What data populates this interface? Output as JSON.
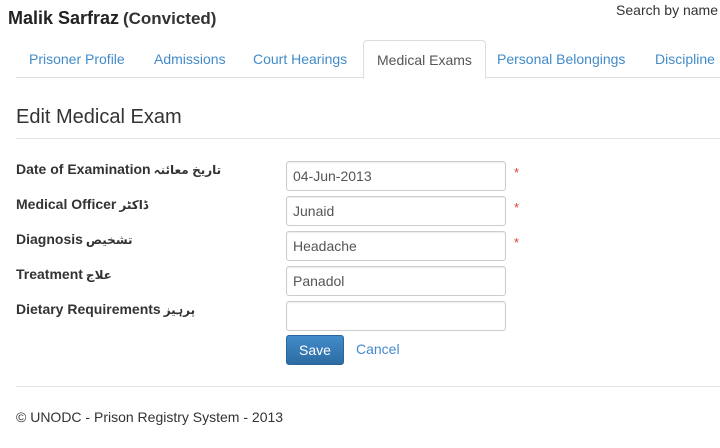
{
  "header": {
    "name": "Malik Sarfraz",
    "status": "(Convicted)",
    "search_link": "Search by name"
  },
  "tabs": [
    {
      "label": "Prisoner Profile",
      "active": false
    },
    {
      "label": "Admissions",
      "active": false
    },
    {
      "label": "Court Hearings",
      "active": false
    },
    {
      "label": "Medical Exams",
      "active": true
    },
    {
      "label": "Personal Belongings",
      "active": false
    },
    {
      "label": "Discipline",
      "active": false
    }
  ],
  "page_title": "Edit Medical Exam",
  "form": {
    "fields": [
      {
        "label": "Date of Examination",
        "label_urdu": "تاریخ معائنہ",
        "value": "04-Jun-2013",
        "required": "*"
      },
      {
        "label": "Medical Officer",
        "label_urdu": "ڈاکٹر",
        "value": "Junaid",
        "required": "*"
      },
      {
        "label": "Diagnosis",
        "label_urdu": "تشخیص",
        "value": "Headache",
        "required": "*"
      },
      {
        "label": "Treatment",
        "label_urdu": "علاج",
        "value": "Panadol"
      },
      {
        "label": "Dietary Requirements",
        "label_urdu": "پرہیز",
        "value": ""
      }
    ],
    "save_label": "Save",
    "cancel_label": "Cancel"
  },
  "footer": {
    "text": "© UNODC - Prison Registry System - 2013"
  },
  "colors": {
    "link": "#428bca",
    "primary_button": "#3071a9",
    "required": "#e0403a"
  }
}
